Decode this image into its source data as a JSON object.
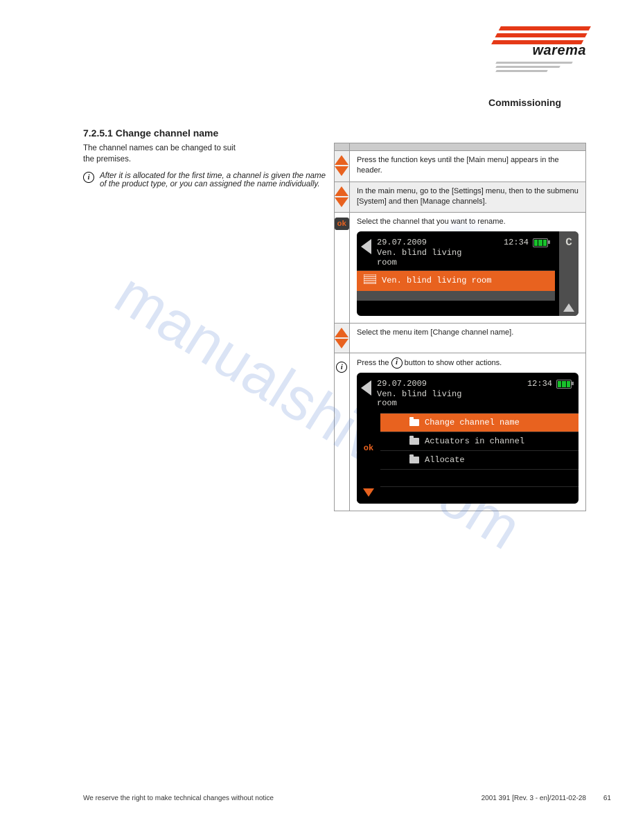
{
  "logo_name": "warema",
  "page_subtitle": "Commissioning",
  "section_title": "7.2.5.1 Change channel name",
  "intro_text": "The channel names can be changed to suit the premises.",
  "info_text": "After it is allocated for the first time, a channel is given the name of the product type, or you can assigned the name individually.",
  "steps": [
    {
      "type": "arrows",
      "bg": "plain",
      "text": "Press the function keys until the [Main menu] appears in the header."
    },
    {
      "type": "arrows",
      "bg": "alt",
      "text": "In the main menu, go to the [Settings] menu, then to the submenu [System] and then [Manage channels]."
    },
    {
      "type": "ok",
      "text": "Select the channel that you want to rename."
    },
    {
      "type": "arrows",
      "bg": "plain",
      "text": "Select the menu item [Change channel name]."
    },
    {
      "type": "info",
      "text": "Press the   button to show other actions."
    }
  ],
  "screen1": {
    "date": "29.07.2009",
    "time": "12:34",
    "title_line1": "Ven. blind living",
    "title_line2": "room",
    "item": "Ven. blind living room",
    "side_letter": "C"
  },
  "screen2": {
    "date": "29.07.2009",
    "time": "12:34",
    "title_line1": "Ven. blind living",
    "title_line2": "room",
    "items": [
      "Change channel name",
      "Actuators in channel",
      "Allocate"
    ],
    "left_ok": "ok"
  },
  "footer_left": "We reserve the right to make technical changes without notice",
  "footer_right": "2001 391 [Rev. 3 - en]/2011-02-28",
  "page_number": "61",
  "watermark": "manualshive.com"
}
